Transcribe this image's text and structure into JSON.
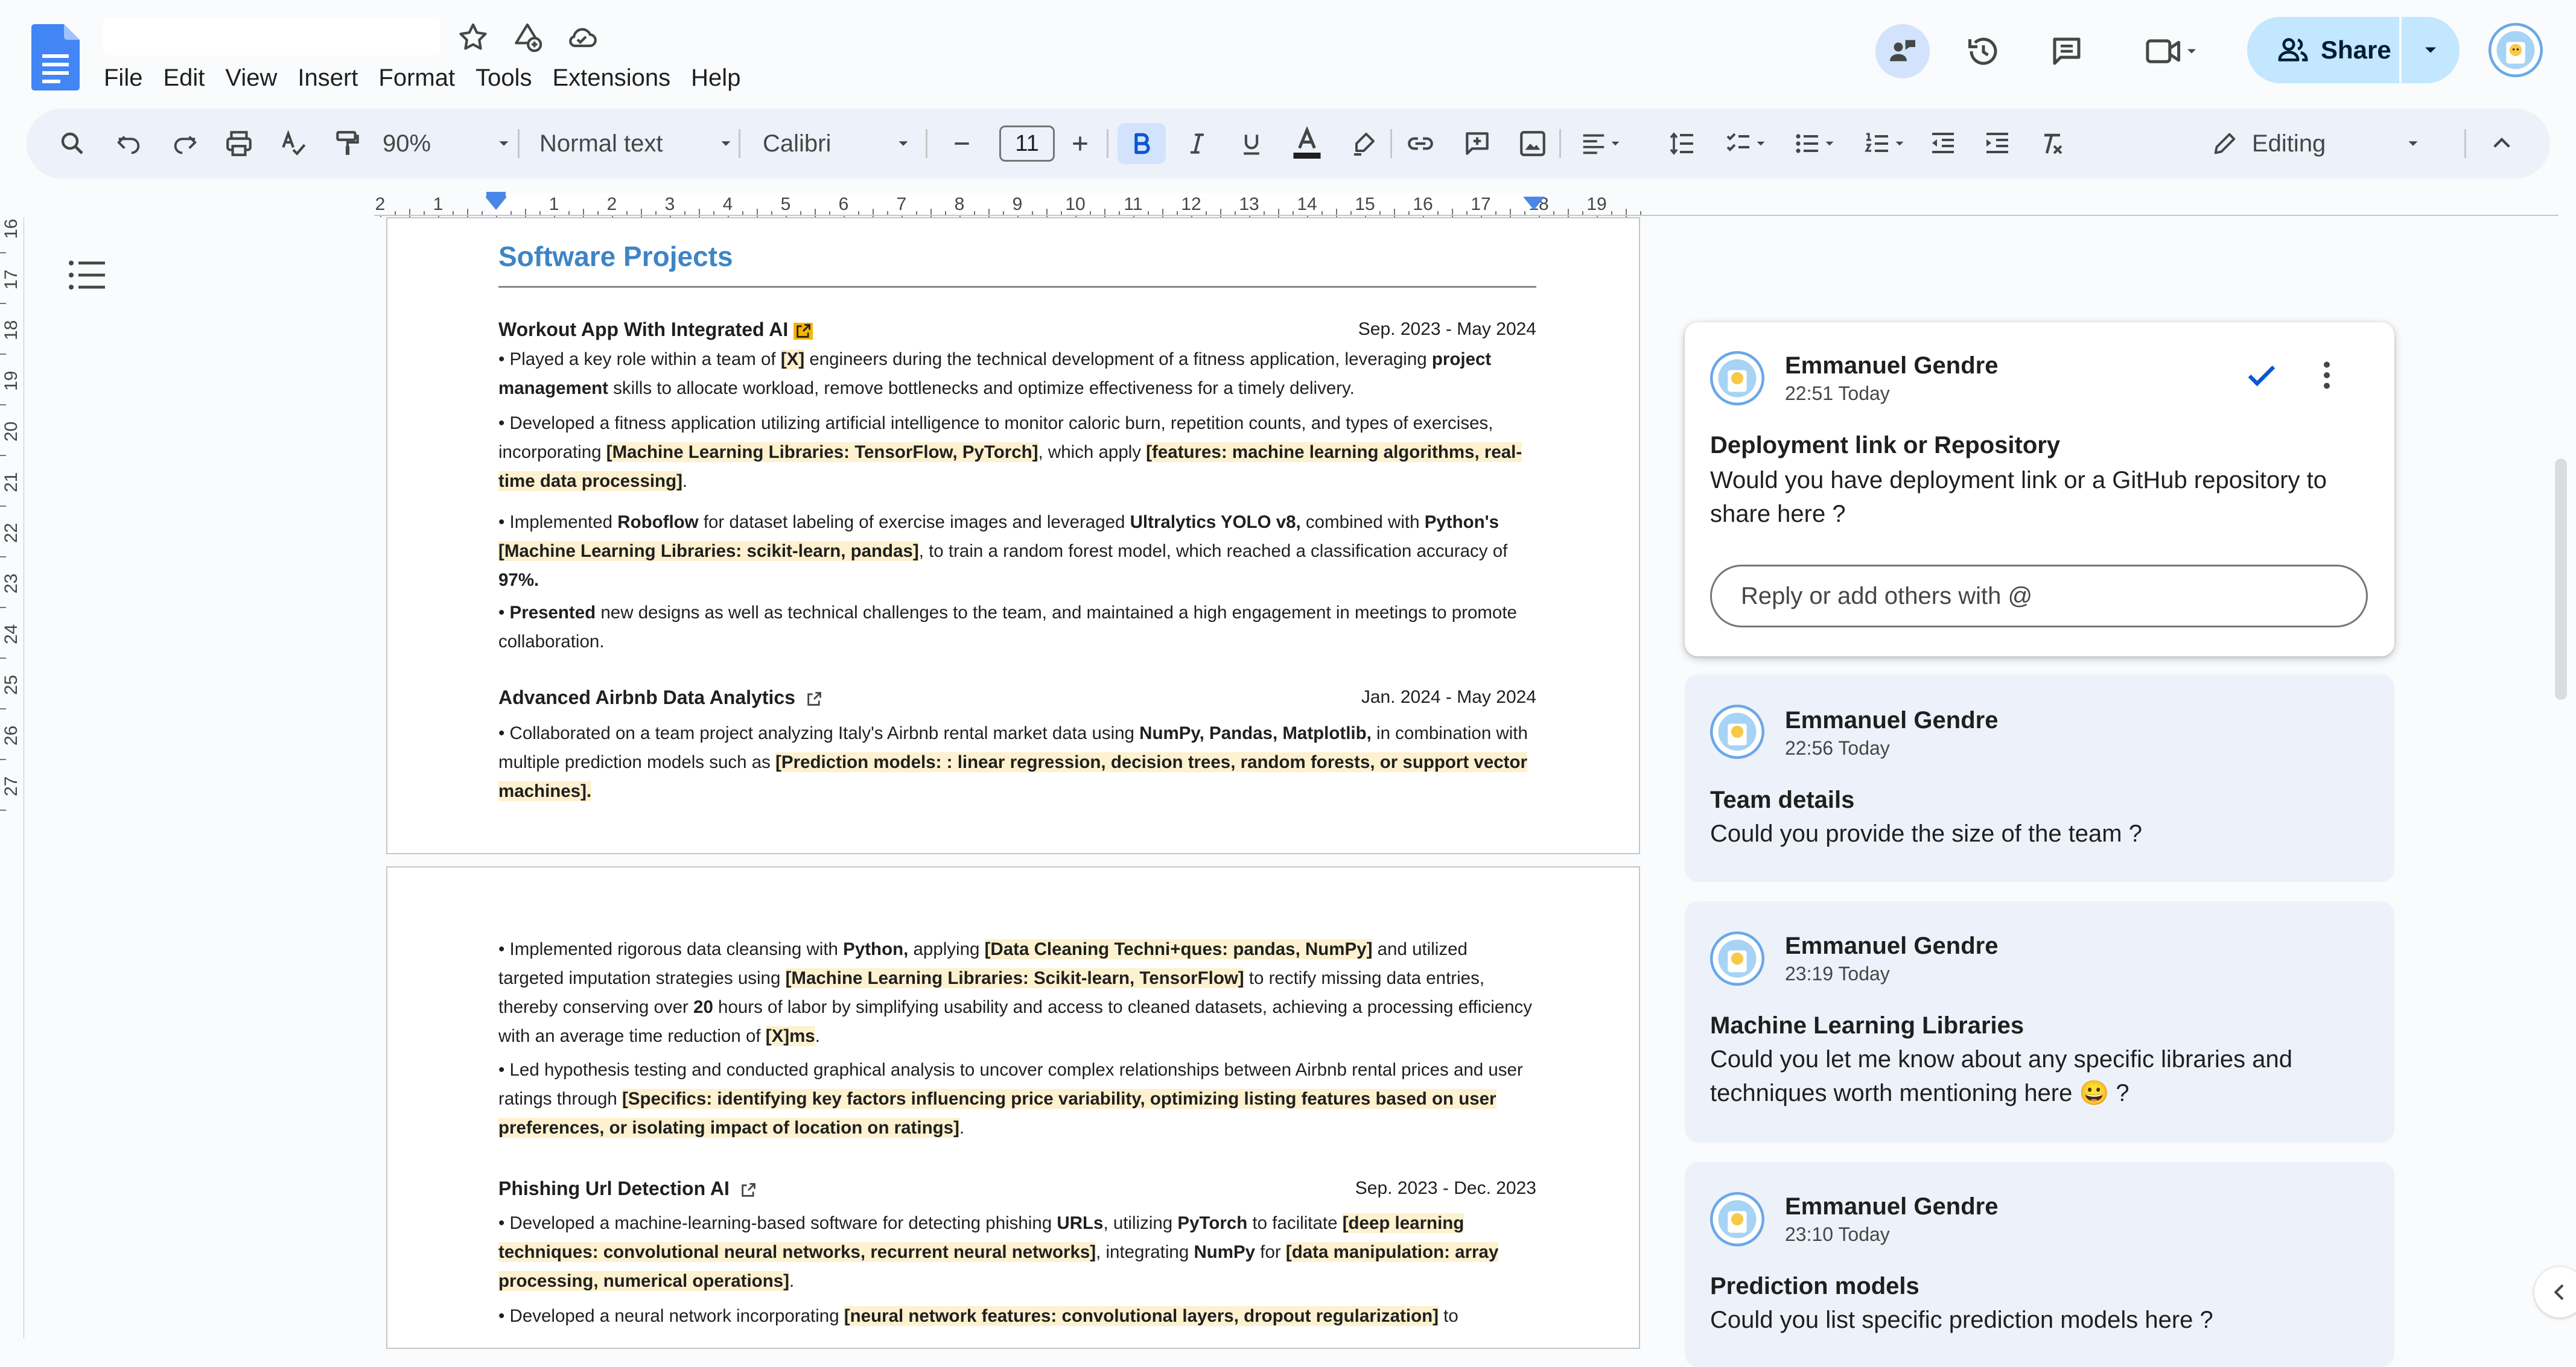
{
  "menu": [
    "File",
    "Edit",
    "View",
    "Insert",
    "Format",
    "Tools",
    "Extensions",
    "Help"
  ],
  "header": {
    "share_label": "Share"
  },
  "toolbar": {
    "zoom": "90%",
    "style": "Normal text",
    "font": "Calibri",
    "font_size": "11",
    "mode": "Editing"
  },
  "ruler_h": [
    "2",
    "1",
    "1",
    "2",
    "3",
    "4",
    "5",
    "6",
    "7",
    "8",
    "9",
    "10",
    "11",
    "12",
    "13",
    "14",
    "15",
    "16",
    "17",
    "18",
    "19"
  ],
  "ruler_v": [
    "16",
    "17",
    "18",
    "19",
    "20",
    "21",
    "22",
    "23",
    "24",
    "25",
    "26",
    "27"
  ],
  "doc": {
    "section_title": "Software Projects",
    "proj1": {
      "title": "Workout App With Integrated AI",
      "date": "Sep. 2023 - May 2024",
      "b1": [
        "• Played a key role within a team of ",
        "[X]",
        " engineers during the technical development of a fitness application, leveraging ",
        "project management",
        " skills to allocate workload, remove bottlenecks and optimize effectiveness for a timely delivery."
      ],
      "b2": [
        "• Developed a fitness application utilizing artificial intelligence to monitor caloric burn, repetition counts, and types of exercises, incorporating ",
        "[Machine Learning Libraries: TensorFlow, PyTorch]",
        ", which apply ",
        "[features: machine learning algorithms, real-time data processing]",
        "."
      ],
      "b3": [
        "• Implemented ",
        "Roboflow",
        " for dataset labeling of exercise images and leveraged ",
        "Ultralytics YOLO v8,",
        " combined with ",
        "Python's",
        " ",
        "[Machine Learning Libraries: scikit-learn, pandas]",
        ", to train a random forest model, which reached a classification accuracy of ",
        "97%."
      ],
      "b4": [
        "• ",
        "Presented",
        " new designs as well as technical challenges to the team, and maintained a high engagement in meetings to promote collaboration."
      ]
    },
    "proj2": {
      "title": "Advanced Airbnb Data Analytics",
      "date": "Jan. 2024 - May 2024",
      "b1": [
        "• Collaborated on a team project analyzing Italy's Airbnb rental market data using ",
        "NumPy, Pandas, Matplotlib,",
        " in combination with multiple prediction models such as ",
        "[Prediction models: : linear regression, decision trees, random forests, or support vector machines]."
      ],
      "b2": [
        "• Implemented rigorous data cleansing with ",
        "Python,",
        " applying ",
        "[Data Cleaning Techni+ques: pandas, NumPy]",
        " and utilized targeted imputation strategies using ",
        "[Machine Learning Libraries: Scikit-learn, TensorFlow]",
        " to rectify missing data entries, thereby conserving over ",
        "20",
        " hours of labor by simplifying usability and access to cleaned datasets, achieving a processing efficiency with an average time reduction of ",
        "[X]",
        "ms",
        "."
      ],
      "b3": [
        "• Led hypothesis testing and conducted graphical analysis to uncover complex relationships between Airbnb rental prices and user ratings through ",
        "[Specifics: identifying key factors influencing price variability, optimizing listing features based on user preferences, or isolating impact of location on ratings]",
        "."
      ]
    },
    "proj3": {
      "title": "Phishing Url Detection AI",
      "date": "Sep. 2023 - Dec. 2023",
      "b1": [
        "• Developed a machine-learning-based software for detecting phishing ",
        "URLs",
        ", utilizing ",
        "PyTorch",
        " to facilitate ",
        "[deep learning techniques: convolutional neural networks, recurrent neural networks]",
        ", integrating ",
        "NumPy",
        " for ",
        "[data manipulation: array processing, numerical operations]",
        "."
      ],
      "b2": [
        "• Developed a neural network incorporating ",
        "[neural network features: convolutional layers, dropout regularization]",
        " to"
      ]
    }
  },
  "comments": [
    {
      "author": "Emmanuel Gendre",
      "time": "22:51 Today",
      "title": "Deployment link or Repository",
      "body": "Would you have deployment link or a GitHub repository to share here ?",
      "reply_placeholder": "Reply or add others with @"
    },
    {
      "author": "Emmanuel Gendre",
      "time": "22:56 Today",
      "title": "Team details",
      "body": "Could you provide the size of the team ?"
    },
    {
      "author": "Emmanuel Gendre",
      "time": "23:19 Today",
      "title": "Machine Learning Libraries",
      "body": "Could you let me know about any specific libraries and techniques worth mentioning here 😀 ?"
    },
    {
      "author": "Emmanuel Gendre",
      "time": "23:10 Today",
      "title": "Prediction models",
      "body": "Could you list specific prediction models here ?"
    }
  ],
  "colors": {
    "accent": "#0b57d0",
    "share_bg": "#c2e7ff",
    "highlight": "#fdf1cf",
    "section_title": "#3d85c6",
    "toolbar_bg": "#edf2fa"
  }
}
